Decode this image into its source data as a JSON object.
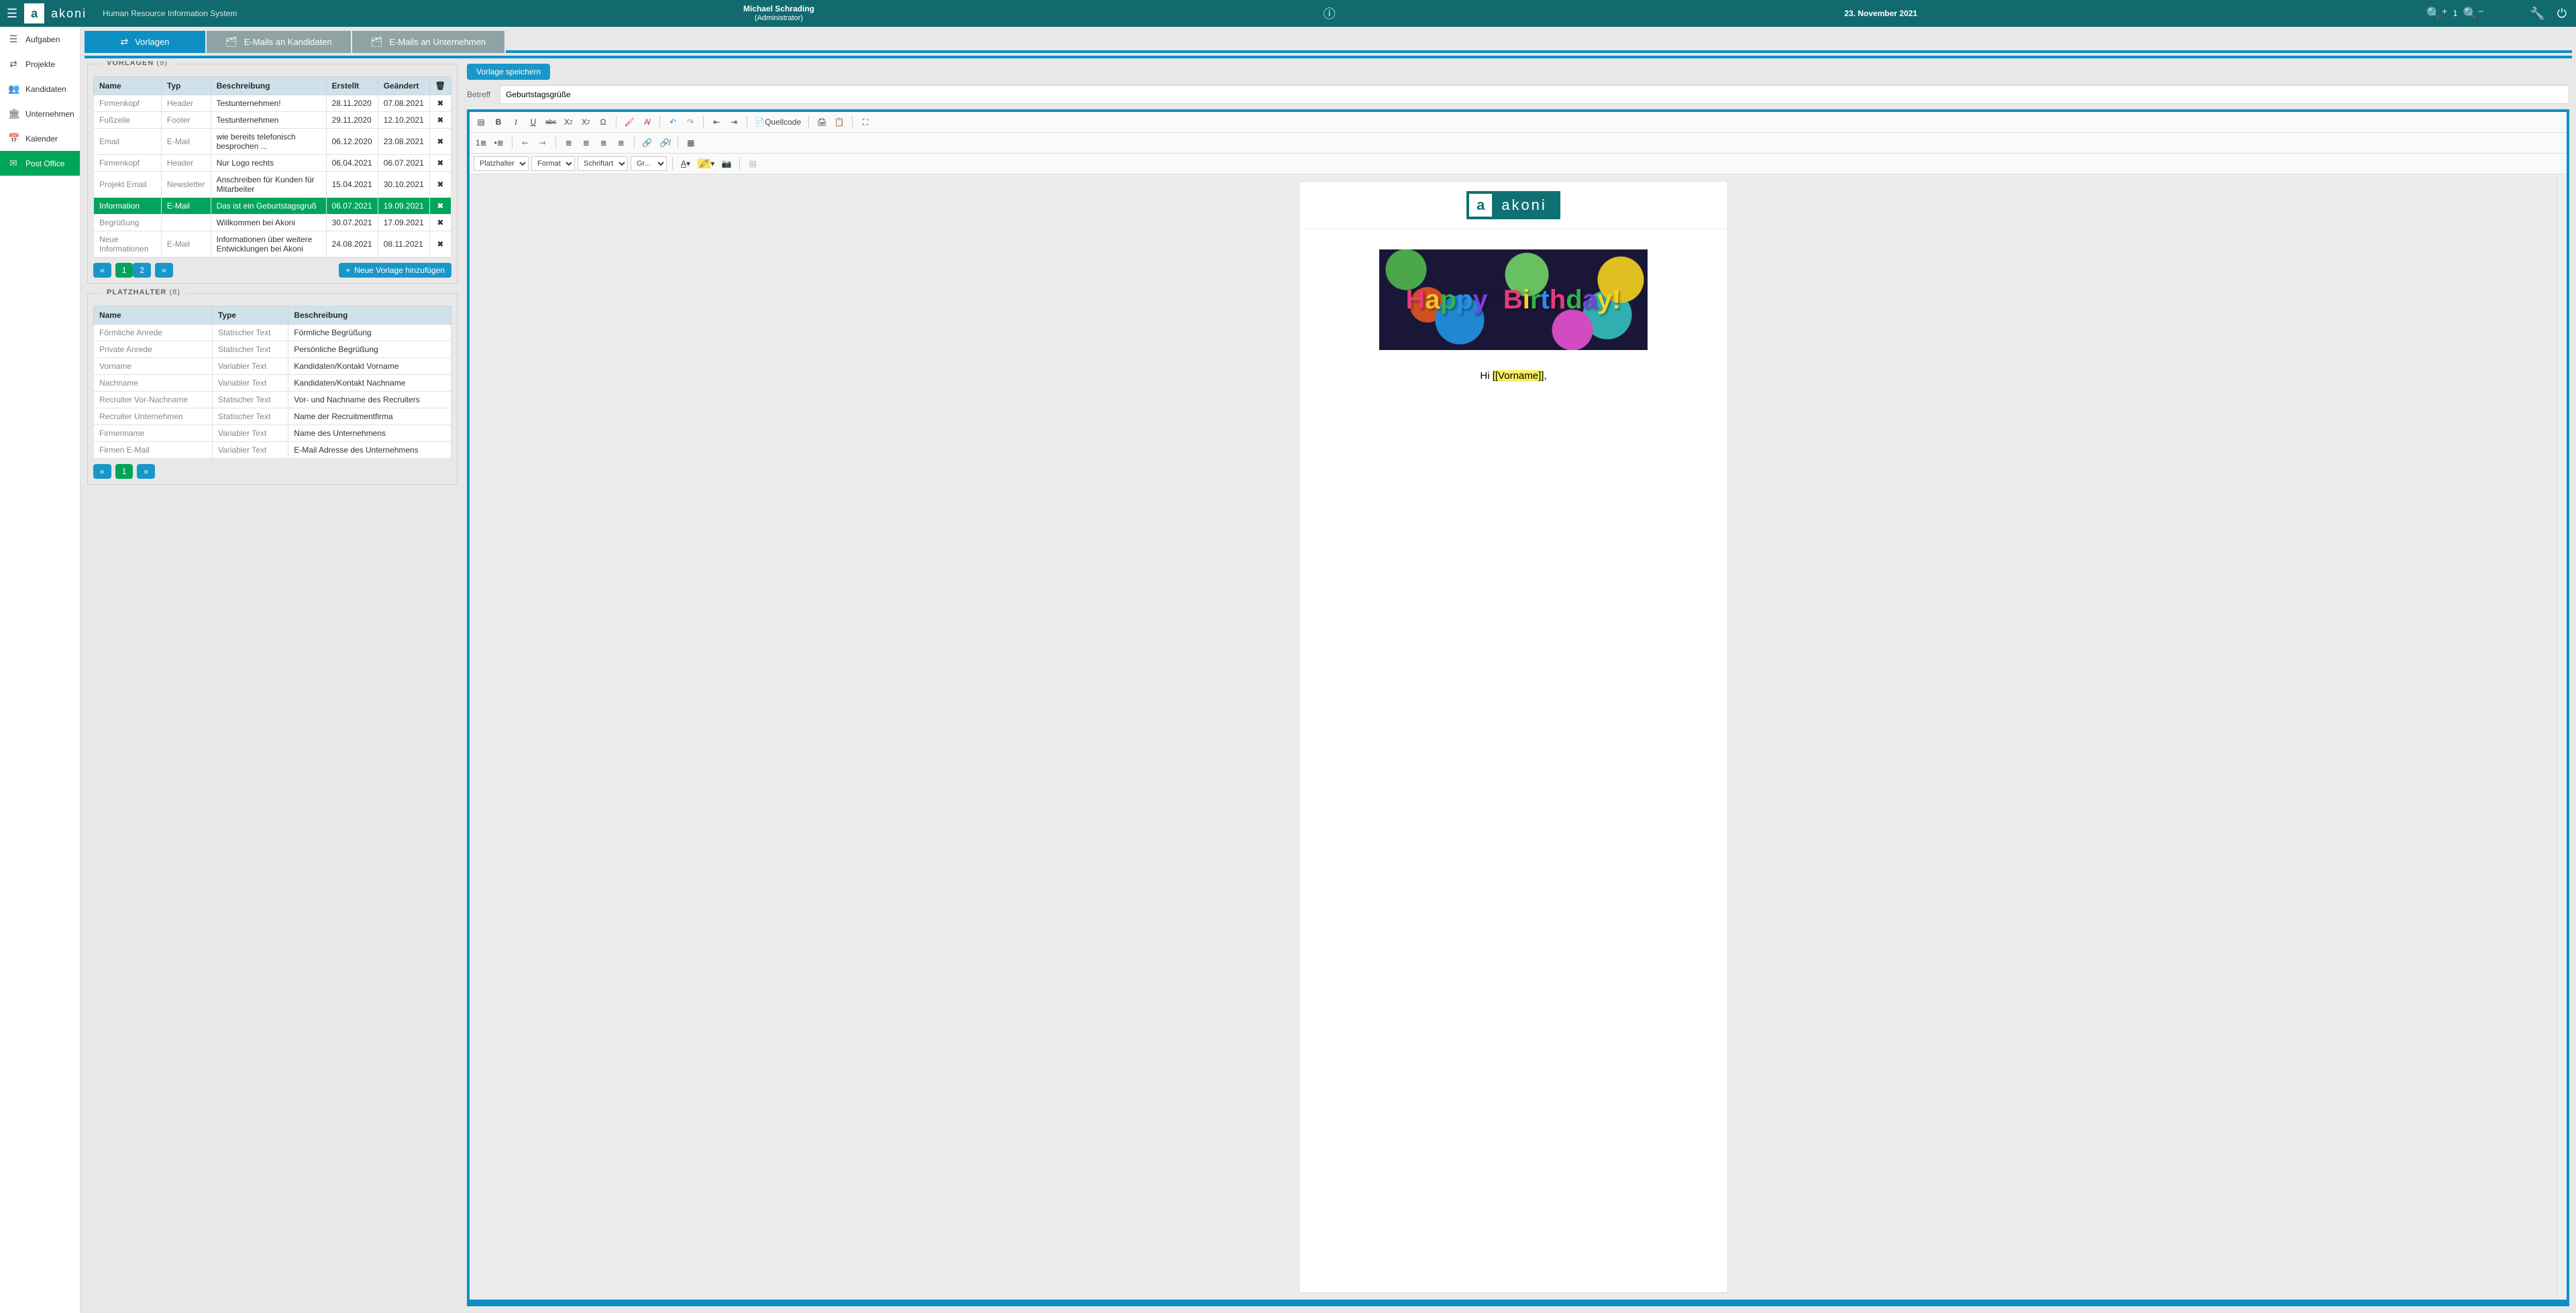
{
  "topbar": {
    "brand": "akoni",
    "subtitle": "Human Resource Information System",
    "user_name": "Michael Schrading",
    "user_role": "(Administrator)",
    "date": "23. November 2021",
    "zoom_value": "1"
  },
  "sidebar": {
    "items": [
      {
        "icon": "☰",
        "label": "Aufgaben"
      },
      {
        "icon": "⇄",
        "label": "Projekte"
      },
      {
        "icon": "👥",
        "label": "Kandidaten"
      },
      {
        "icon": "🏛",
        "label": "Unternehmen"
      },
      {
        "icon": "📅",
        "label": "Kalender"
      },
      {
        "icon": "✉",
        "label": "Post Office"
      }
    ],
    "active_index": 5
  },
  "tabs": [
    {
      "icon": "⇄",
      "label": "Vorlagen"
    },
    {
      "icon": "🗂",
      "label": "E-Mails an Kandidaten"
    },
    {
      "icon": "🗂",
      "label": "E-Mails an Unternehmen"
    }
  ],
  "active_tab": 0,
  "vorlagen_panel": {
    "title": "VORLAGEN",
    "count": "(9)",
    "headers": {
      "name": "Name",
      "typ": "Typ",
      "beschr": "Beschreibung",
      "erstellt": "Erstellt",
      "geandert": "Geändert"
    },
    "rows": [
      {
        "name": "Firmenkopf",
        "typ": "Header",
        "beschr": "Testunternehmen!",
        "erstellt": "28.11.2020",
        "geandert": "07.08.2021"
      },
      {
        "name": "Fußzeile",
        "typ": "Footer",
        "beschr": "Testunternehmen",
        "erstellt": "29.11.2020",
        "geandert": "12.10.2021"
      },
      {
        "name": "Email",
        "typ": "E-Mail",
        "beschr": "wie bereits telefonisch besprochen ...",
        "erstellt": "06.12.2020",
        "geandert": "23.08.2021"
      },
      {
        "name": "Firmenkopf",
        "typ": "Header",
        "beschr": "Nur Logo rechts",
        "erstellt": "06.04.2021",
        "geandert": "06.07.2021"
      },
      {
        "name": "Projekt Email",
        "typ": "Newsletter",
        "beschr": "Anschreiben für Kunden für Mitarbeiter",
        "erstellt": "15.04.2021",
        "geandert": "30.10.2021"
      },
      {
        "name": "Information",
        "typ": "E-Mail",
        "beschr": "Das ist ein Geburtstagsgruß",
        "erstellt": "06.07.2021",
        "geandert": "19.09.2021",
        "selected": true
      },
      {
        "name": "Begrüßung",
        "typ": "",
        "beschr": "Willkommen bei Akoni",
        "erstellt": "30.07.2021",
        "geandert": "17.09.2021"
      },
      {
        "name": "Neue Informationen",
        "typ": "E-Mail",
        "beschr": "Informationen über weitere Entwicklungen bei Akoni",
        "erstellt": "24.08.2021",
        "geandert": "08.11.2021"
      }
    ],
    "pages": [
      "1",
      "2"
    ],
    "active_page": 0,
    "add_btn": "Neue Vorlage hinzufügen"
  },
  "platzhalter_panel": {
    "title": "PLATZHALTER",
    "count": "(8)",
    "headers": {
      "name": "Name",
      "type": "Type",
      "beschr": "Beschreibung"
    },
    "rows": [
      {
        "name": "Förmliche Anrede",
        "type": "Statischer Text",
        "beschr": "Förmliche Begrüßung"
      },
      {
        "name": "Private Anrede",
        "type": "Statischer Text",
        "beschr": "Persönliche Begrüßung"
      },
      {
        "name": "Vorname",
        "type": "Variabler Text",
        "beschr": "Kandidaten/Kontakt Vorname"
      },
      {
        "name": "Nachname",
        "type": "Variabler Text",
        "beschr": "Kandidaten/Kontakt Nachname"
      },
      {
        "name": "Recruiter Vor-Nachname",
        "type": "Statischer Text",
        "beschr": "Vor- und Nachname des Recruiters"
      },
      {
        "name": "Recruiter Unternehmen",
        "type": "Statischer Text",
        "beschr": "Name der Recruitmentfirma"
      },
      {
        "name": "Firmenname",
        "type": "Variabler Text",
        "beschr": "Name des Unternehmens"
      },
      {
        "name": "Firmen E-Mail",
        "type": "Variabler Text",
        "beschr": "E-Mail Adresse des Unternehmens"
      }
    ],
    "pages": [
      "1"
    ]
  },
  "editor": {
    "save_btn": "Vorlage speichern",
    "subject_label": "Betreff",
    "subject_value": "Geburtstagsgrüße",
    "combos": {
      "platzhalter": "Platzhalter",
      "format": "Format",
      "schriftart": "Schriftart",
      "groesse": "Gr..."
    },
    "quellcode_btn": "Quellcode",
    "greeting_prefix": "Hi ",
    "greeting_placeholder": "[[Vorname]]",
    "greeting_suffix": ",",
    "brand_text": "akoni"
  }
}
